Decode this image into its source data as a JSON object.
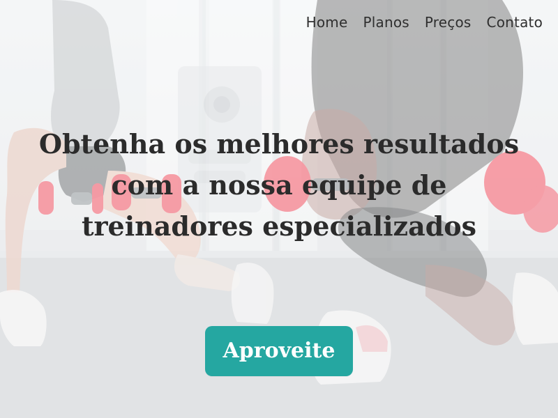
{
  "nav": {
    "items": [
      {
        "label": "Home"
      },
      {
        "label": "Planos"
      },
      {
        "label": "Preços"
      },
      {
        "label": "Contato"
      }
    ]
  },
  "hero": {
    "headline": "Obtenha os melhores resultados com a nossa equipe de treinadores especializados",
    "cta_label": "Aproveite"
  },
  "colors": {
    "cta_background": "#25a7a1",
    "text": "#2b2b2b",
    "accent_dumbbell": "#f05c6c"
  }
}
